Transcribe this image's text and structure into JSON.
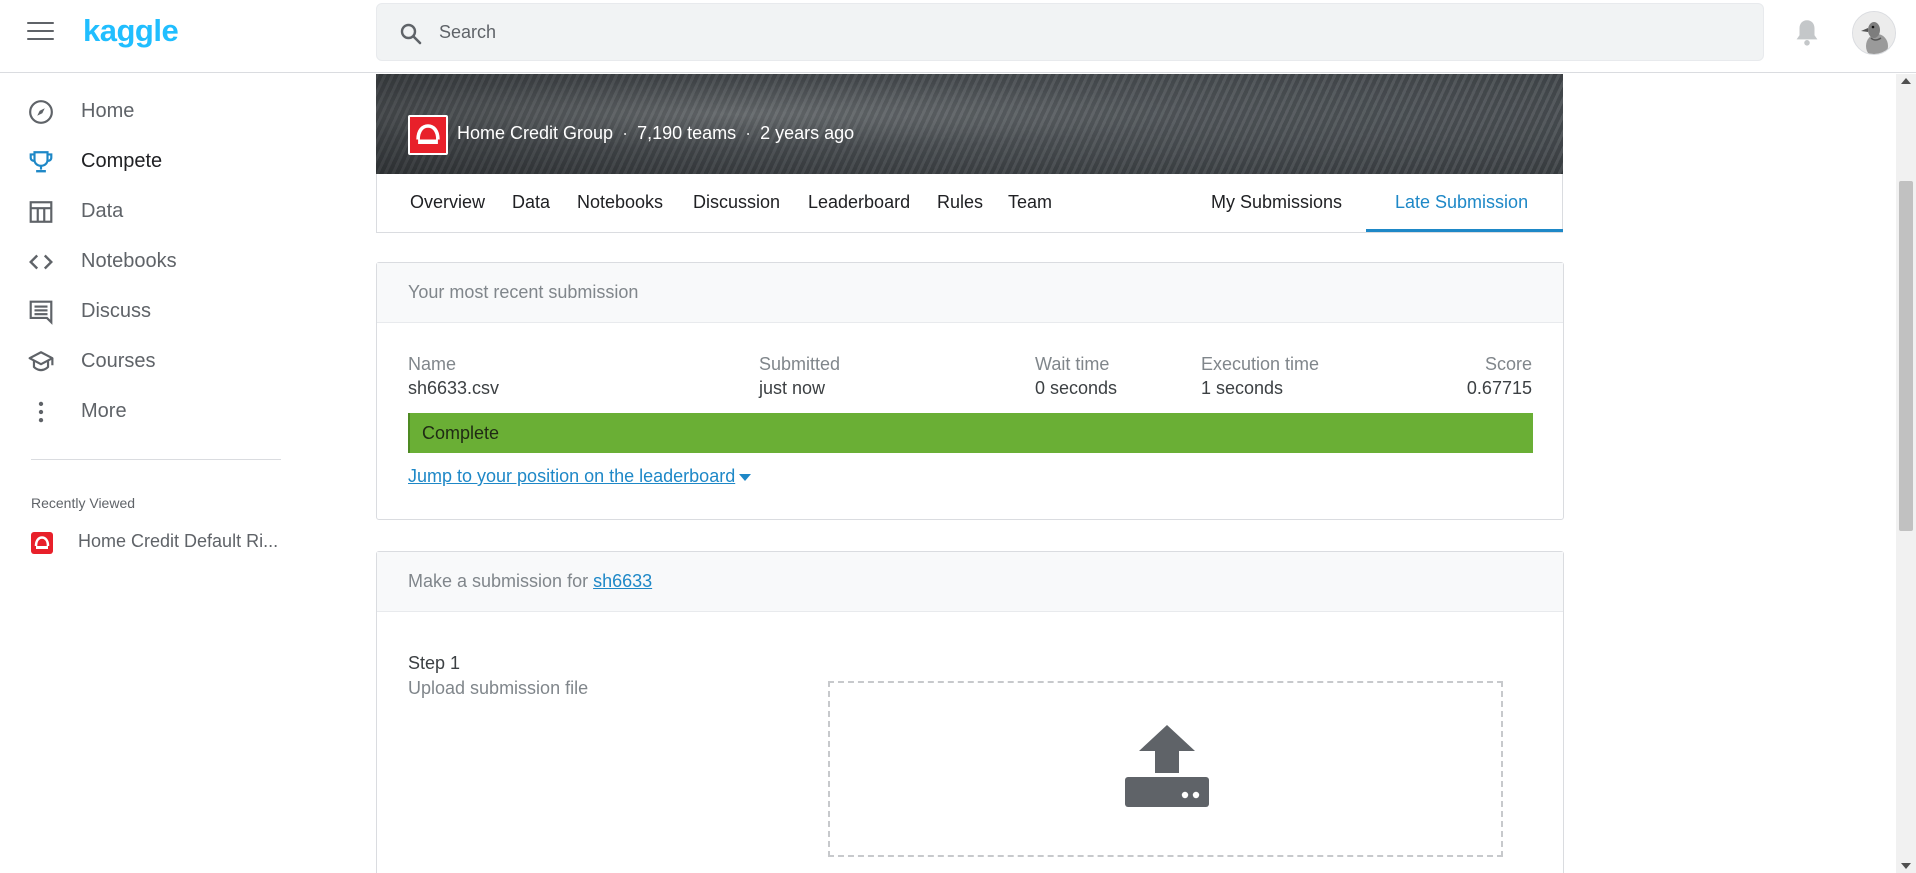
{
  "header": {
    "logo_text": "kaggle",
    "search_placeholder": "Search"
  },
  "sidebar": {
    "items": [
      {
        "label": "Home",
        "icon": "compass-icon"
      },
      {
        "label": "Compete",
        "icon": "trophy-icon",
        "active": true
      },
      {
        "label": "Data",
        "icon": "table-icon"
      },
      {
        "label": "Notebooks",
        "icon": "code-icon"
      },
      {
        "label": "Discuss",
        "icon": "comment-icon"
      },
      {
        "label": "Courses",
        "icon": "school-icon"
      },
      {
        "label": "More",
        "icon": "more-vert-icon"
      }
    ],
    "recent_title": "Recently Viewed",
    "recent_items": [
      {
        "label": "Home Credit Default Ri..."
      }
    ]
  },
  "competition": {
    "host": "Home Credit Group",
    "teams": "7,190 teams",
    "age": "2 years ago",
    "tabs_left": [
      "Overview",
      "Data",
      "Notebooks",
      "Discussion",
      "Leaderboard",
      "Rules",
      "Team"
    ],
    "tabs_right": [
      "My Submissions",
      "Late Submission"
    ],
    "active_tab": "Late Submission"
  },
  "recent_submission": {
    "heading": "Your most recent submission",
    "columns": {
      "name_label": "Name",
      "submitted_label": "Submitted",
      "wait_label": "Wait time",
      "exec_label": "Execution time",
      "score_label": "Score"
    },
    "values": {
      "name": "sh6633.csv",
      "submitted": "just now",
      "wait": "0 seconds",
      "exec": "1 seconds",
      "score": "0.67715"
    },
    "status": "Complete",
    "jump_link": "Jump to your position on the leaderboard"
  },
  "new_submission": {
    "heading_prefix": "Make a submission for ",
    "user_link": "sh6633",
    "step_title": "Step 1",
    "step_subtitle": "Upload submission file"
  },
  "colors": {
    "kaggle_blue": "#20beff",
    "accent": "#1e88c7",
    "status_complete": "#6aaf35",
    "brand_red": "#e8202a"
  }
}
